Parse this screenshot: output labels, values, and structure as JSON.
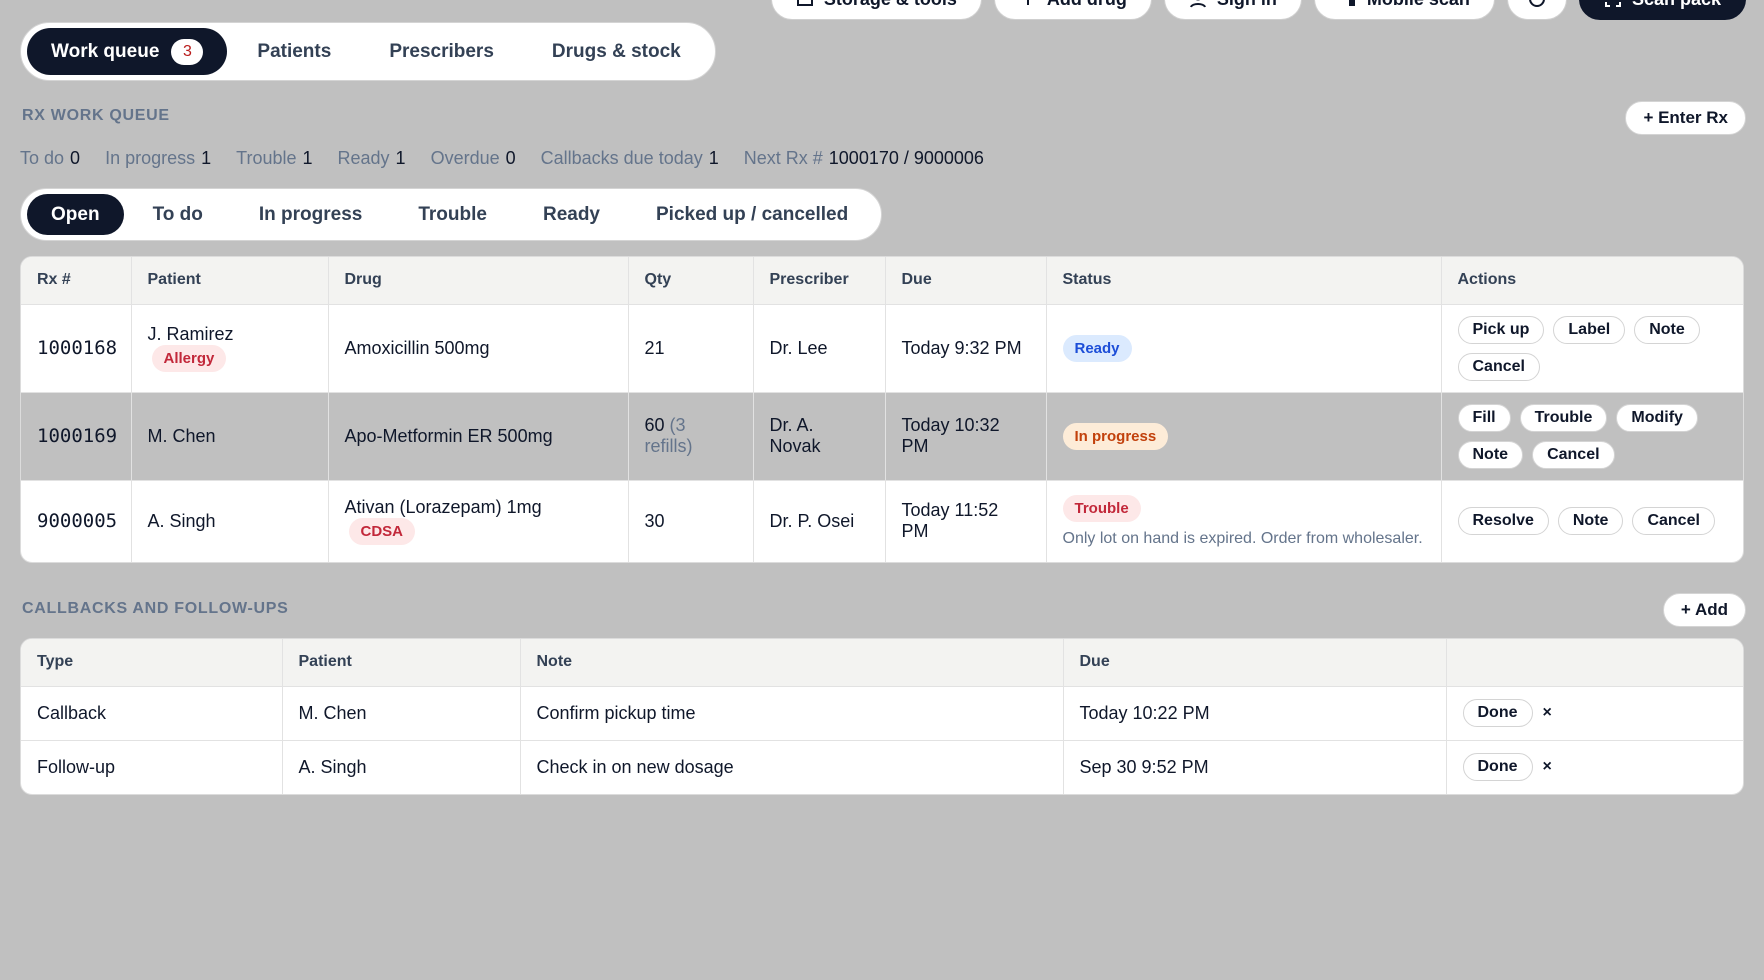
{
  "toolbar": {
    "storage": "Storage & tools",
    "add_drug": "Add drug",
    "sign_in": "Sign in",
    "mobile_scan": "Mobile scan",
    "scan_pack": "Scan pack"
  },
  "nav": {
    "work_queue": "Work queue",
    "work_queue_count": "3",
    "patients": "Patients",
    "prescribers": "Prescribers",
    "drugs": "Drugs & stock"
  },
  "queue": {
    "title": "RX WORK QUEUE",
    "enter_rx": "+ Enter Rx",
    "stats": [
      {
        "label": "To do",
        "value": "0"
      },
      {
        "label": "In progress",
        "value": "1"
      },
      {
        "label": "Trouble",
        "value": "1"
      },
      {
        "label": "Ready",
        "value": "1"
      },
      {
        "label": "Overdue",
        "value": "0"
      },
      {
        "label": "Callbacks due today",
        "value": "1"
      },
      {
        "label": "Next Rx #",
        "value": "1000170 / 9000006"
      }
    ],
    "filters": [
      "Open",
      "To do",
      "In progress",
      "Trouble",
      "Ready",
      "Picked up / cancelled"
    ],
    "columns": [
      "Rx #",
      "Patient",
      "Drug",
      "Qty",
      "Prescriber",
      "Due",
      "Status",
      "Actions"
    ],
    "rows": [
      {
        "rx": "1000168",
        "patient": "J. Ramirez",
        "patient_tag": "Allergy",
        "drug": "Amoxicillin 500mg",
        "drug_tag": "",
        "qty": "21",
        "qty_note": "",
        "prescriber": "Dr. Lee",
        "due": "Today 9:32 PM",
        "status": "Ready",
        "status_note": "",
        "actions": [
          "Pick up",
          "Label",
          "Note",
          "Cancel"
        ]
      },
      {
        "rx": "1000169",
        "patient": "M. Chen",
        "patient_tag": "",
        "drug": "Apo-Metformin ER 500mg",
        "drug_tag": "",
        "qty": "60",
        "qty_note": "(3 refills)",
        "prescriber": "Dr. A. Novak",
        "due": "Today 10:32 PM",
        "status": "In progress",
        "status_note": "",
        "actions": [
          "Fill",
          "Trouble",
          "Modify",
          "Note",
          "Cancel"
        ]
      },
      {
        "rx": "9000005",
        "patient": "A. Singh",
        "patient_tag": "",
        "drug": "Ativan (Lorazepam) 1mg",
        "drug_tag": "CDSA",
        "qty": "30",
        "qty_note": "",
        "prescriber": "Dr. P. Osei",
        "due": "Today 11:52 PM",
        "status": "Trouble",
        "status_note": "Only lot on hand is expired. Order from wholesaler.",
        "actions": [
          "Resolve",
          "Note",
          "Cancel"
        ]
      }
    ]
  },
  "callbacks": {
    "title": "CALLBACKS AND FOLLOW-UPS",
    "add": "+ Add",
    "columns": [
      "Type",
      "Patient",
      "Note",
      "Due",
      ""
    ],
    "rows": [
      {
        "type": "Callback",
        "patient": "M. Chen",
        "note": "Confirm pickup time",
        "due": "Today 10:22 PM",
        "done": "Done",
        "dismiss": "×"
      },
      {
        "type": "Follow-up",
        "patient": "A. Singh",
        "note": "Check in on new dosage",
        "due": "Sep 30 9:52 PM",
        "done": "Done",
        "dismiss": "×"
      }
    ]
  }
}
